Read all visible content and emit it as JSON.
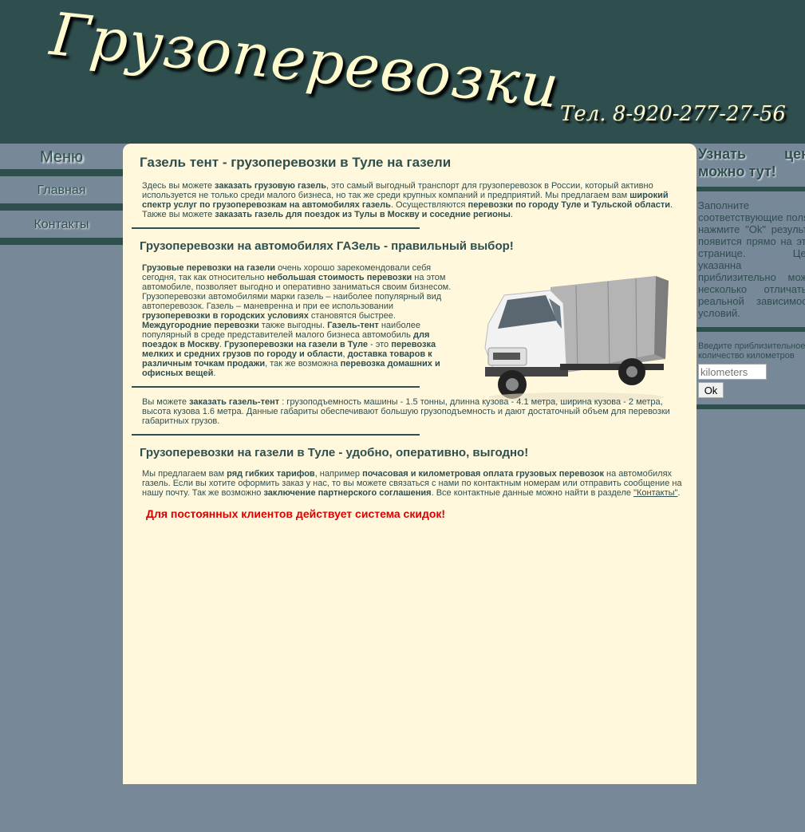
{
  "header": {
    "title": "Грузоперевозки",
    "phone": "Тел. 8-920-277-27-56"
  },
  "menu": {
    "title": "Меню",
    "items": [
      {
        "label": "Главная"
      },
      {
        "label": "Контакты"
      }
    ]
  },
  "content": {
    "h1": "Газель тент - грузоперевозки в Туле на газели",
    "p1": [
      "Здесь вы можете ",
      "заказать грузовую газель",
      ", это самый выгодный транспорт для грузоперевозок в России, который активно используется не только среди малого бизнеса, но так же среди крупных компаний и предприятий. Мы предлагаем вам ",
      "широкий спектр услуг по грузоперевозкам на автомобилях газель",
      ". Осуществляются ",
      "перевозки по городу Туле и Тульской области",
      ". Также вы можете ",
      "заказать газель для поездок из Тулы в Москву и соседние регионы",
      "."
    ],
    "h2": "Грузоперевозки на автомобилях ГАЗель - правильный выбор!",
    "p2": [
      "Грузовые перевозки на газели",
      " очень хорошо зарекомендовали себя сегодня, так как относительно ",
      "небольшая стоимость перевозки",
      " на этом автомобиле, позволяет выгодно и оперативно заниматься своим бизнесом. Грузоперевозки автомобилями марки газель – наиболее популярный вид автоперевозок. Газель – маневренна и при ее использовании ",
      "грузоперевозки в городских условиях",
      " становятся быстрее. ",
      "Междугородние перевозки",
      " также выгодны. ",
      "Газель-тент",
      " наиболее популярный в среде представителей малого бизнеса автомобиль ",
      "для поездок в Москву",
      ". ",
      "Грузоперевозки на газели в Туле",
      " - это ",
      "перевозка мелких и средних грузов по городу и области",
      ", ",
      "доставка товаров к различным точкам продажи",
      ", так же возможна ",
      "перевозка домашних и офисных вещей",
      "."
    ],
    "p3": [
      "Вы можете ",
      "заказать газель-тент",
      " : грузоподъемность машины - 1.5 тонны, длинна кузова - 4.1 метра, ширина кузова - 2 метра, высота кузова 1.6 метра. Данные габариты обеспечивают большую грузоподъемность и дают достаточный объем для перевозки габаритных грузов."
    ],
    "h3": "Грузоперевозки на газели в Туле - удобно, оперативно, выгодно!",
    "p4": [
      "Мы предлагаем вам ",
      "ряд гибких тарифов",
      ", например ",
      "почасовая и километровая оплата грузовых перевозок",
      " на автомобилях газель. Если вы хотите оформить заказ у нас, то вы можете связаться с нами по контактным номерам или отправить сообщение на нашу почту. Так же возможно ",
      "заключение партнерского соглашения",
      ". Все контактные данные можно найти в разделе ",
      "\"Контакты\"",
      "."
    ],
    "discount": "Для постоянных клиентов действует система скидок!"
  },
  "right": {
    "title": "Узнать цену можно тут!",
    "desc": "Заполните соответствующие поля и нажмите \"Ok\" результат появится прямо на этой странице. Цена указанна приблизительно может несколько отличаться реальной зависимости условий.",
    "km_label": "Введите приблизительное количество километров",
    "km_placeholder": "kilometers",
    "ok_label": "Ok"
  },
  "colors": {
    "header_bg": "#2f4f4f",
    "page_bg": "#778899",
    "content_bg": "#fff8dc",
    "title_color": "#fffacd",
    "discount_red": "#dd0000"
  },
  "icons": {
    "truck": "gazelle-truck-image"
  }
}
